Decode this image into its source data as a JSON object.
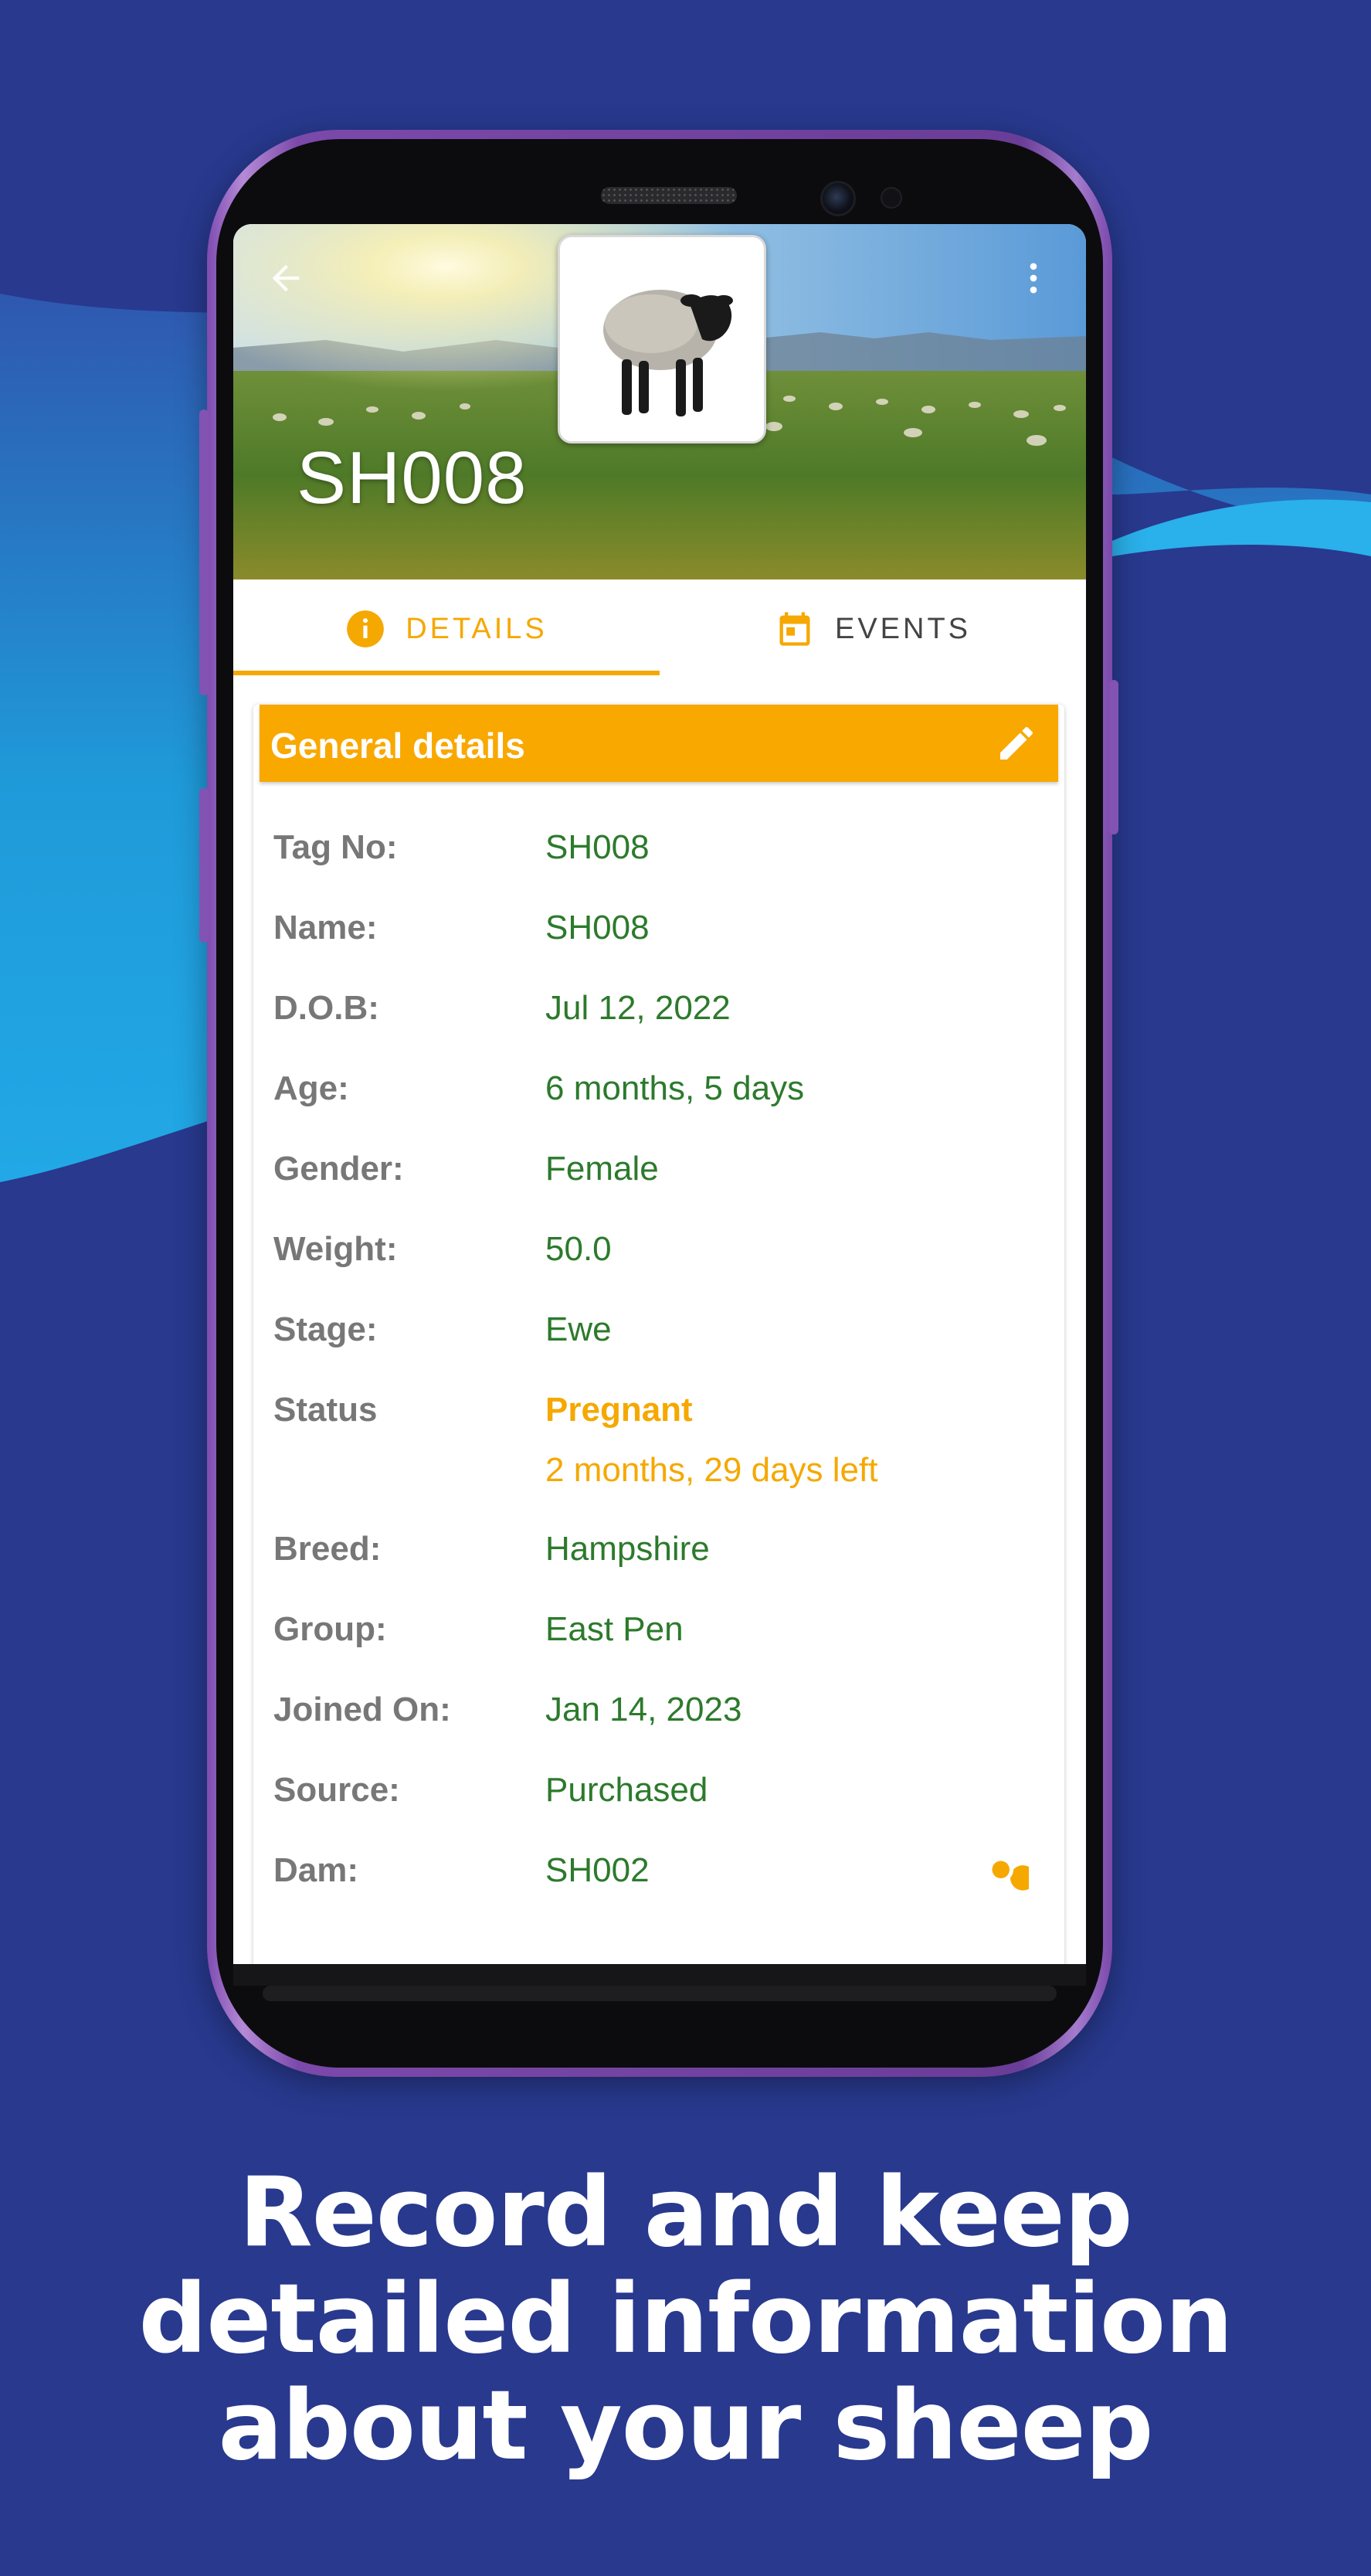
{
  "app": {
    "animal_tag": "SH008"
  },
  "header": {
    "back_icon": "arrow-left-icon",
    "menu_icon": "more-vertical-icon"
  },
  "tabs": [
    {
      "label": "DETAILS",
      "icon": "info-icon",
      "active": true
    },
    {
      "label": "EVENTS",
      "icon": "calendar-icon",
      "active": false
    }
  ],
  "card": {
    "title": "General details",
    "edit_icon": "pencil-icon"
  },
  "details": {
    "tag_no": {
      "label": "Tag No:",
      "value": "SH008"
    },
    "name": {
      "label": "Name:",
      "value": "SH008"
    },
    "dob": {
      "label": "D.O.B:",
      "value": "Jul 12, 2022"
    },
    "age": {
      "label": "Age:",
      "value": "6 months, 5 days"
    },
    "gender": {
      "label": "Gender:",
      "value": "Female"
    },
    "weight": {
      "label": "Weight:",
      "value": "50.0"
    },
    "stage": {
      "label": "Stage:",
      "value": "Ewe"
    },
    "status": {
      "label": "Status",
      "value": "Pregnant",
      "sub": "2 months, 29 days left"
    },
    "breed": {
      "label": "Breed:",
      "value": "Hampshire"
    },
    "group": {
      "label": "Group:",
      "value": "East Pen"
    },
    "joined_on": {
      "label": "Joined On:",
      "value": "Jan 14, 2023"
    },
    "source": {
      "label": "Source:",
      "value": "Purchased"
    },
    "dam": {
      "label": "Dam:",
      "value": "SH002"
    }
  },
  "colors": {
    "accent": "#f9a800",
    "value_green": "#2c7a2c",
    "background": "#28398e"
  },
  "caption": {
    "line1": "Record and keep",
    "line2": "detailed information",
    "line3": "about your sheep"
  }
}
